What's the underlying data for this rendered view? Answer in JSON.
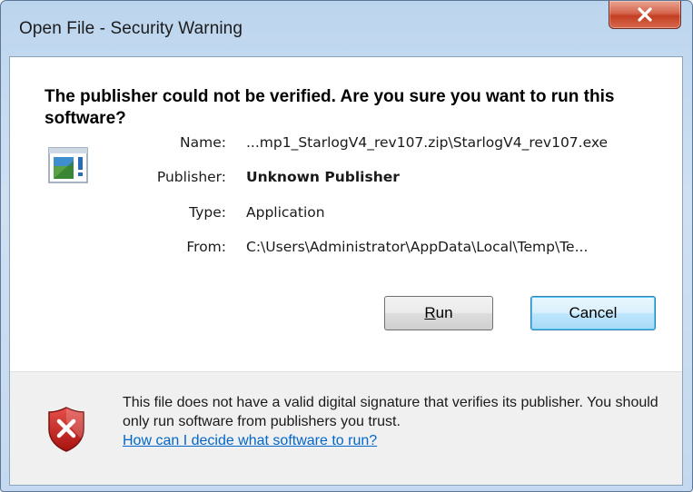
{
  "window": {
    "title": "Open File - Security Warning",
    "close_label": "X"
  },
  "dialog": {
    "heading": "The publisher could not be verified.  Are you sure you want to run this software?",
    "fields": [
      {
        "label": "Name:",
        "value": "...mp1_StarlogV4_rev107.zip\\StarlogV4_rev107.exe",
        "bold": false
      },
      {
        "label": "Publisher:",
        "value": "Unknown Publisher",
        "bold": true
      },
      {
        "label": "Type:",
        "value": "Application",
        "bold": false
      },
      {
        "label": "From:",
        "value": "C:\\Users\\Administrator\\AppData\\Local\\Temp\\Te...",
        "bold": false
      }
    ],
    "file_icon": "application-window-icon"
  },
  "buttons": {
    "run_label": "Run",
    "cancel_label": "Cancel"
  },
  "warning": {
    "icon": "shield-error-icon",
    "text": "This file does not have a valid digital signature that verifies its publisher.  You should only run software from publishers you trust.",
    "link_text": "How can I decide what software to run?"
  },
  "colors": {
    "link": "#0066cc",
    "close_button": "#c33f22",
    "default_button_border": "#3c7fb1",
    "shield_red": "#c0201e"
  }
}
